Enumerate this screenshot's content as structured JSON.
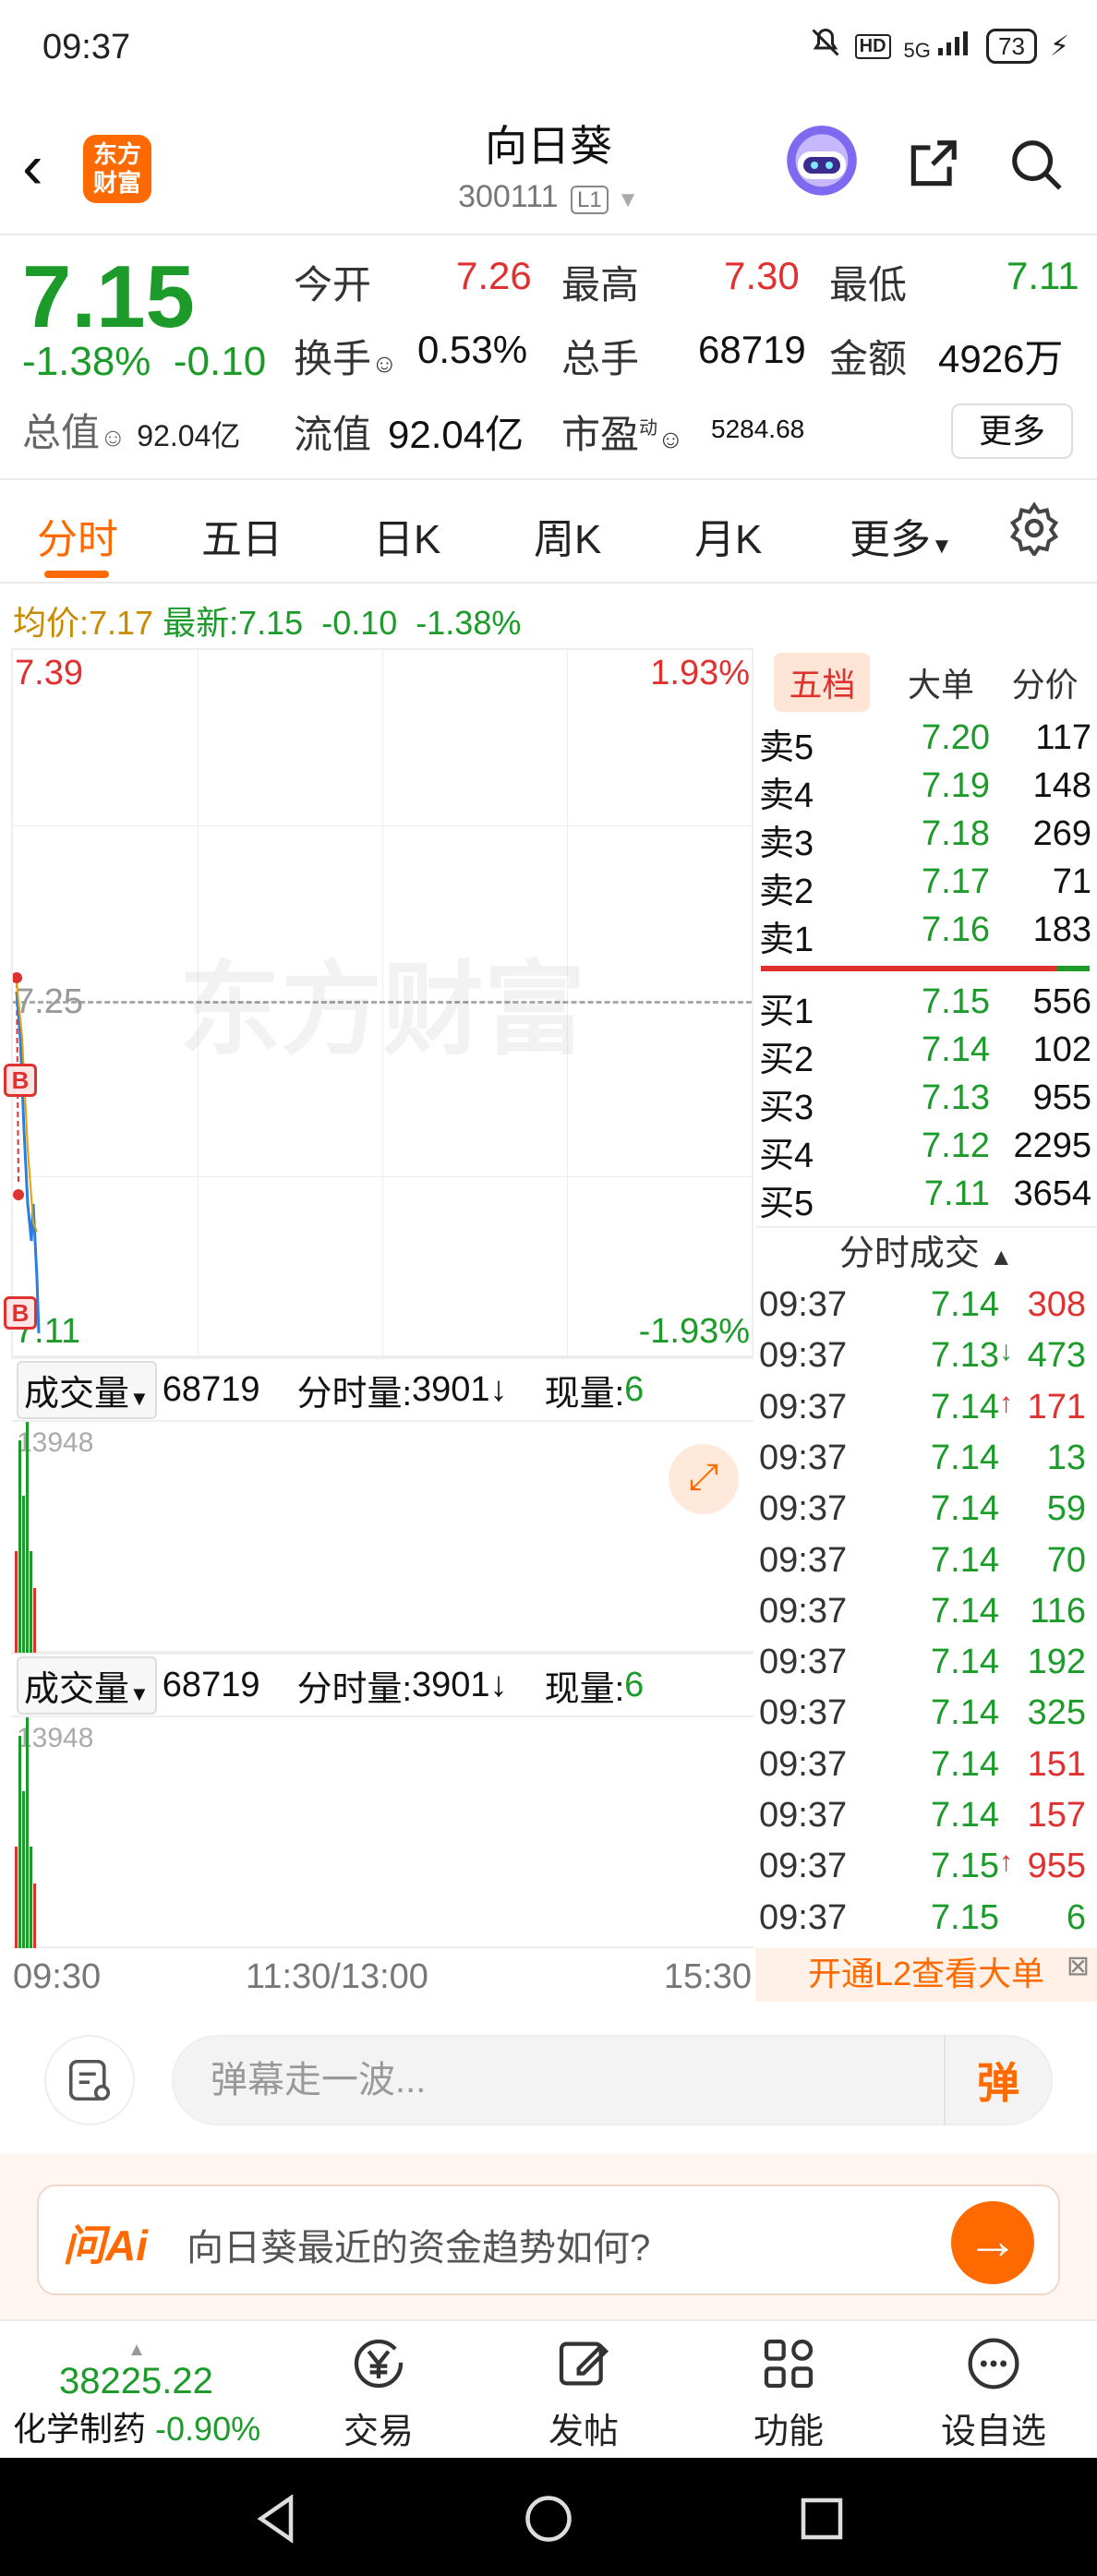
{
  "status": {
    "time": "09:37",
    "network": "5G",
    "battery": "73"
  },
  "header": {
    "title": "向日葵",
    "code": "300111",
    "level": "L1",
    "logo_line1": "东方",
    "logo_line2": "财富"
  },
  "quote": {
    "price": "7.15",
    "change_pct": "-1.38%",
    "change": "-0.10",
    "open_label": "今开",
    "open": "7.26",
    "high_label": "最高",
    "high": "7.30",
    "low_label": "最低",
    "low": "7.11",
    "turnover_label": "换手",
    "turnover": "0.53%",
    "volume_label": "总手",
    "volume": "68719",
    "amount_label": "金额",
    "amount": "4926万",
    "mcap_label": "总值",
    "mcap": "92.04亿",
    "float_label": "流值",
    "float": "92.04亿",
    "pe_label": "市盈",
    "pe_sup": "动",
    "pe": "5284.68",
    "more": "更多"
  },
  "tabs": [
    "分时",
    "五日",
    "日K",
    "周K",
    "月K",
    "更多"
  ],
  "avgline": {
    "avg_label": "均价:",
    "avg": "7.17",
    "last_label": "最新:",
    "last": "7.15",
    "chg": "-0.10",
    "pct": "-1.38%"
  },
  "chart": {
    "top_price": "7.39",
    "top_pct": "1.93%",
    "mid_price": "7.25",
    "bottom_price": "7.11",
    "bottom_pct": "-1.93%",
    "watermark": "东方财富",
    "b_mark": "B"
  },
  "volume_panel": {
    "selector": "成交量",
    "total": "68719",
    "period_label": "分时量:",
    "period": "3901",
    "now_label": "现量:",
    "now": "6",
    "max": "13948"
  },
  "time_axis": [
    "09:30",
    "11:30/13:00",
    "15:30"
  ],
  "right_tabs": [
    "五档",
    "大单",
    "分价"
  ],
  "order_book": {
    "asks": [
      {
        "label": "卖5",
        "price": "7.20",
        "vol": "117"
      },
      {
        "label": "卖4",
        "price": "7.19",
        "vol": "148"
      },
      {
        "label": "卖3",
        "price": "7.18",
        "vol": "269"
      },
      {
        "label": "卖2",
        "price": "7.17",
        "vol": "71"
      },
      {
        "label": "卖1",
        "price": "7.16",
        "vol": "183"
      }
    ],
    "bids": [
      {
        "label": "买1",
        "price": "7.15",
        "vol": "556"
      },
      {
        "label": "买2",
        "price": "7.14",
        "vol": "102"
      },
      {
        "label": "买3",
        "price": "7.13",
        "vol": "955"
      },
      {
        "label": "买4",
        "price": "7.12",
        "vol": "2295"
      },
      {
        "label": "买5",
        "price": "7.11",
        "vol": "3654"
      }
    ]
  },
  "fenshi": {
    "title": "分时成交",
    "trades": [
      {
        "t": "09:37",
        "p": "7.14",
        "a": "",
        "v": "308",
        "dir": "up"
      },
      {
        "t": "09:37",
        "p": "7.13",
        "a": "↓",
        "v": "473",
        "dir": "down"
      },
      {
        "t": "09:37",
        "p": "7.14",
        "a": "↑",
        "v": "171",
        "dir": "up"
      },
      {
        "t": "09:37",
        "p": "7.14",
        "a": "",
        "v": "13",
        "dir": "down"
      },
      {
        "t": "09:37",
        "p": "7.14",
        "a": "",
        "v": "59",
        "dir": "down"
      },
      {
        "t": "09:37",
        "p": "7.14",
        "a": "",
        "v": "70",
        "dir": "down"
      },
      {
        "t": "09:37",
        "p": "7.14",
        "a": "",
        "v": "116",
        "dir": "down"
      },
      {
        "t": "09:37",
        "p": "7.14",
        "a": "",
        "v": "192",
        "dir": "down"
      },
      {
        "t": "09:37",
        "p": "7.14",
        "a": "",
        "v": "325",
        "dir": "down"
      },
      {
        "t": "09:37",
        "p": "7.14",
        "a": "",
        "v": "151",
        "dir": "up"
      },
      {
        "t": "09:37",
        "p": "7.14",
        "a": "",
        "v": "157",
        "dir": "up"
      },
      {
        "t": "09:37",
        "p": "7.15",
        "a": "↑",
        "v": "955",
        "dir": "up"
      },
      {
        "t": "09:37",
        "p": "7.15",
        "a": "",
        "v": "6",
        "dir": "down"
      }
    ],
    "l2_banner": "开通L2查看大单"
  },
  "comment": {
    "placeholder": "弹幕走一波...",
    "dan": "弹"
  },
  "ai": {
    "logo": "问Ai",
    "question": "向日葵最近的资金趋势如何?"
  },
  "bottom_nav": {
    "index_value": "38225.22",
    "index_name": "化学制药",
    "index_pct": "-0.90%",
    "items": [
      "交易",
      "发帖",
      "功能",
      "设自选"
    ]
  },
  "colors": {
    "up": "#e03131",
    "down": "#1c9b2a",
    "accent": "#ff6a00"
  }
}
